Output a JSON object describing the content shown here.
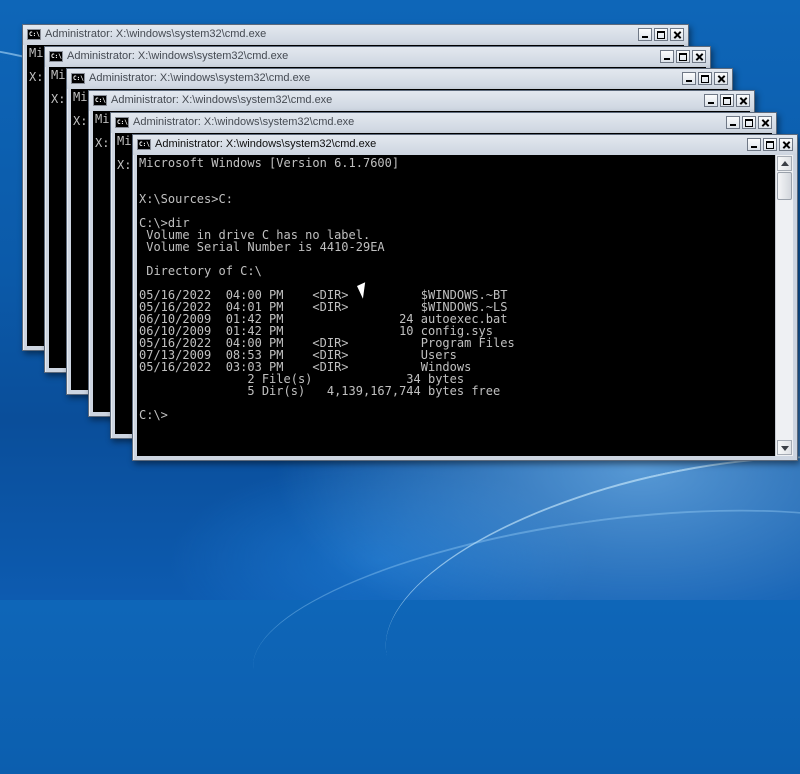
{
  "windows": [
    {
      "title": "Administrator: X:\\windows\\system32\\cmd.exe",
      "icon": "C:\\",
      "lines": [
        "Mi",
        "",
        "X:"
      ]
    },
    {
      "title": "Administrator: X:\\windows\\system32\\cmd.exe",
      "icon": "C:\\",
      "lines": [
        "Mi",
        "",
        "X:"
      ]
    },
    {
      "title": "Administrator: X:\\windows\\system32\\cmd.exe",
      "icon": "C:\\",
      "lines": [
        "Mi",
        "",
        "X:"
      ]
    },
    {
      "title": "Administrator: X:\\windows\\system32\\cmd.exe",
      "icon": "C:\\",
      "lines": [
        "Mi",
        "",
        "X:"
      ]
    },
    {
      "title": "Administrator: X:\\windows\\system32\\cmd.exe",
      "icon": "C:\\",
      "lines": [
        "Mi",
        "",
        "X:"
      ]
    },
    {
      "title": "Administrator: X:\\windows\\system32\\cmd.exe",
      "icon": "C:\\",
      "lines": [
        "Microsoft Windows [Version 6.1.7600]",
        "",
        "",
        "X:\\Sources>C:",
        "",
        "C:\\>dir",
        " Volume in drive C has no label.",
        " Volume Serial Number is 4410-29EA",
        "",
        " Directory of C:\\",
        "",
        "05/16/2022  04:00 PM    <DIR>          $WINDOWS.~BT",
        "05/16/2022  04:01 PM    <DIR>          $WINDOWS.~LS",
        "06/10/2009  01:42 PM                24 autoexec.bat",
        "06/10/2009  01:42 PM                10 config.sys",
        "05/16/2022  04:00 PM    <DIR>          Program Files",
        "07/13/2009  08:53 PM    <DIR>          Users",
        "05/16/2022  03:03 PM    <DIR>          Windows",
        "               2 File(s)             34 bytes",
        "               5 Dir(s)   4,139,167,744 bytes free",
        "",
        "C:\\>"
      ]
    }
  ]
}
